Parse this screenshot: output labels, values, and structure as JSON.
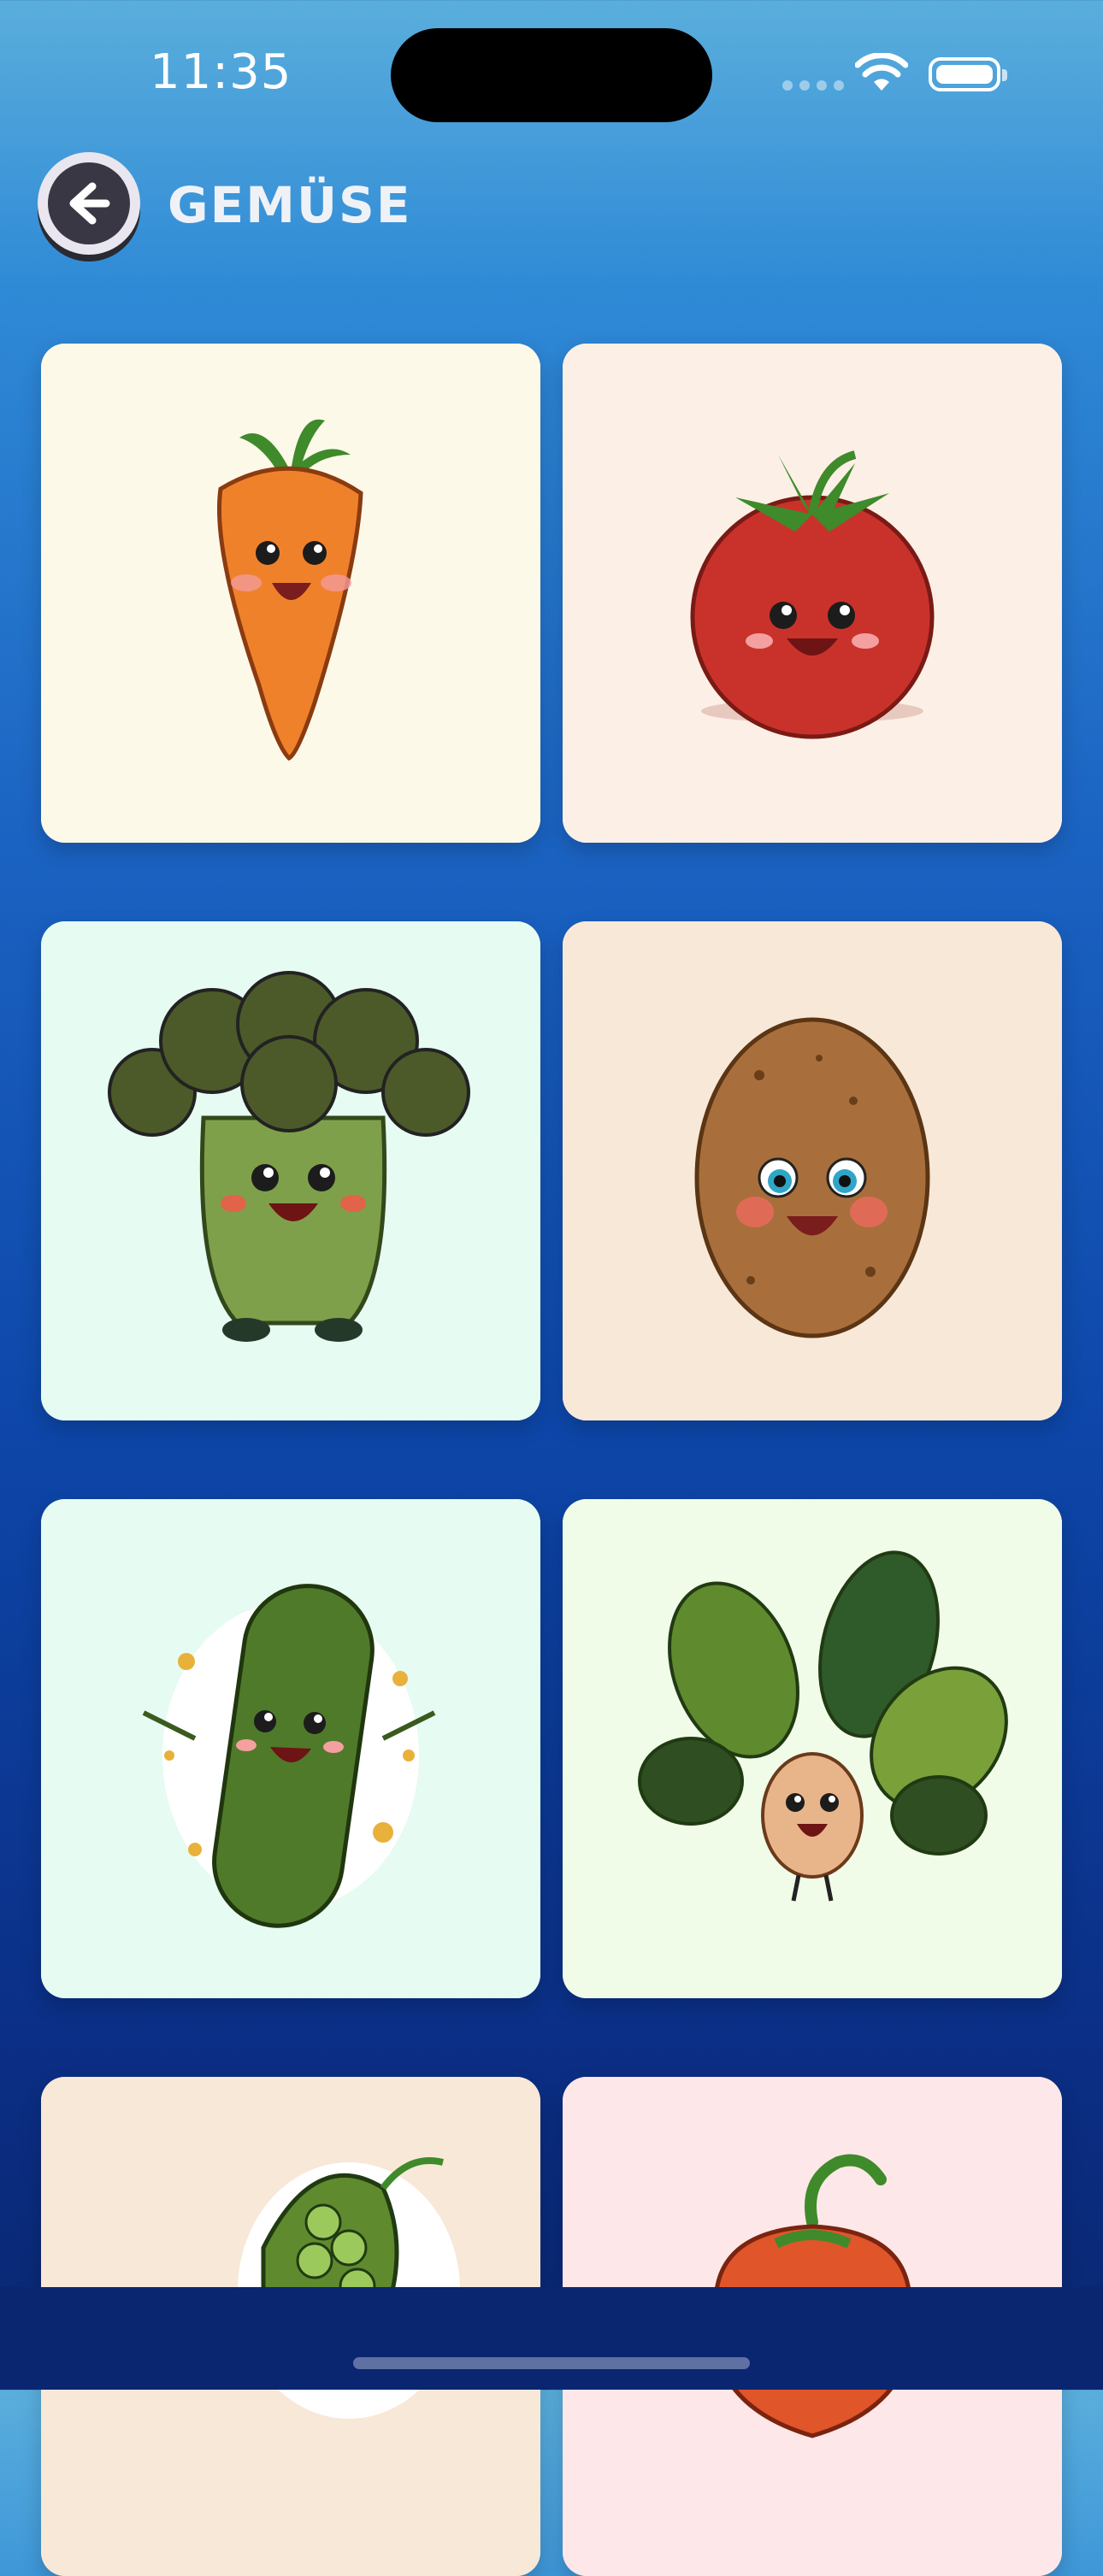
{
  "status_bar": {
    "time": "11:35"
  },
  "header": {
    "title": "GEMÜSE",
    "back_icon": "arrow-left-icon"
  },
  "colors": {
    "accent_dark": "#3a3744",
    "title": "#eef2f7"
  },
  "cards": [
    {
      "name": "card-carrot",
      "image": "carrot-image",
      "bg": "#fdf9e9"
    },
    {
      "name": "card-tomato",
      "image": "tomato-image",
      "bg": "#fcefe6"
    },
    {
      "name": "card-broccoli",
      "image": "broccoli-image",
      "bg": "#e6fbf2"
    },
    {
      "name": "card-potato",
      "image": "potato-image",
      "bg": "#f8e8d8"
    },
    {
      "name": "card-cucumber",
      "image": "cucumber-image",
      "bg": "#e6fbf2"
    },
    {
      "name": "card-spinach",
      "image": "spinach-image",
      "bg": "#f0fbe8"
    },
    {
      "name": "card-peas",
      "image": "peas-image",
      "bg": "#f8e8d8"
    },
    {
      "name": "card-pepper",
      "image": "pepper-image",
      "bg": "#fde7e8"
    }
  ]
}
